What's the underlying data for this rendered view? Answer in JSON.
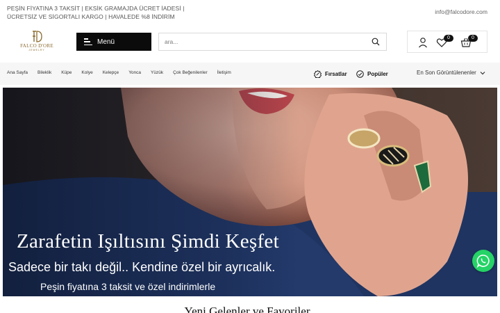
{
  "topbar": {
    "promo_line1": "PEŞİN FİYATINA 3 TAKSİT | EKSİK GRAMAJDA ÜCRET İADESİ |",
    "promo_line2": "ÜCRETSİZ VE SİGORTALI KARGO |  HAVALEDE %8 İNDİRİM",
    "email": "info@falcodore.com"
  },
  "logo": {
    "name": "FALCO D'ORE",
    "sub": "JEWELRY"
  },
  "header": {
    "menu_label": "Menü",
    "search_placeholder": "ara...",
    "favorites_count": "0",
    "cart_count": "0"
  },
  "nav": {
    "links": [
      "Ana Sayfa",
      "Bileklik",
      "Küpe",
      "Kolye",
      "Kelepçe",
      "Yonca",
      "Yüzük",
      "Çok Beğenilenler",
      "İletişim"
    ],
    "deals_label": "Fırsatlar",
    "popular_label": "Popüler",
    "recent_label": "En Son Görüntülenenler"
  },
  "hero": {
    "title": "Zarafetin Işıltısını Şimdi Keşfet",
    "subtitle": "Sadece bir takı değil.. Kendine özel bir ayrıcalık.",
    "subtitle2": "Peşin fiyatına 3 taksit ve özel indirimlerle"
  },
  "section": {
    "title": "Yeni Gelenler ve Favoriler"
  },
  "colors": {
    "accent": "#0b0b0b",
    "gold": "#8a6a2e",
    "whatsapp": "#25d366",
    "hero_bg": "#1e2f52"
  }
}
